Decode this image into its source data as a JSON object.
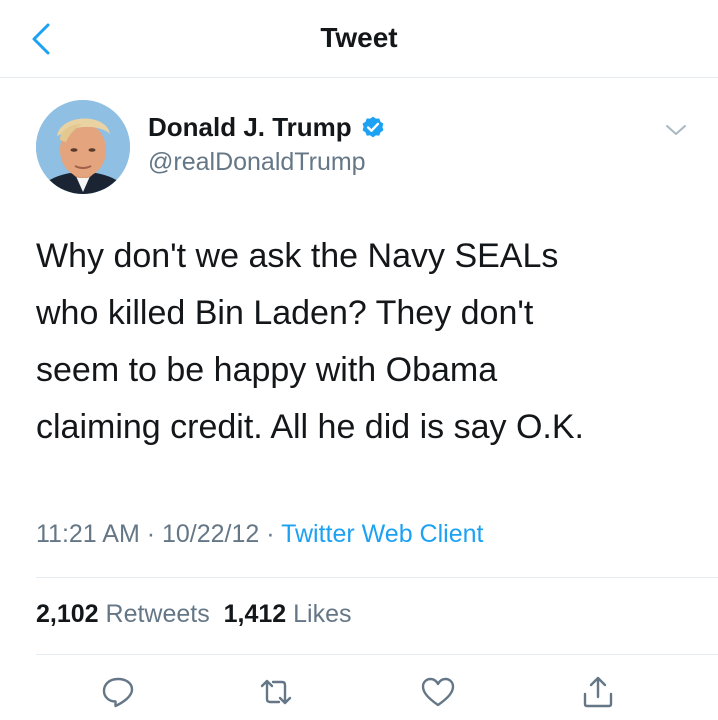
{
  "nav": {
    "title": "Tweet",
    "back_icon": "chevron-left-icon"
  },
  "author": {
    "name": "Donald J. Trump",
    "handle": "@realDonaldTrump",
    "verified_icon": "verified-badge-icon",
    "avatar": "profile-photo"
  },
  "tweet": {
    "text_lines": [
      "Why don't we ask the Navy SEALs",
      "who killed Bin Laden? They don't",
      "seem to be happy with Obama",
      "claiming credit. All he did is say O.K."
    ]
  },
  "meta": {
    "time": "11:21 AM",
    "sep1": " · ",
    "date": "10/22/12",
    "sep2": " · ",
    "client": "Twitter Web Client"
  },
  "stats": {
    "retweets_count": "2,102",
    "retweets_label": "Retweets",
    "likes_count": "1,412",
    "likes_label": "Likes"
  },
  "actions": [
    {
      "icon": "reply-icon"
    },
    {
      "icon": "retweet-icon"
    },
    {
      "icon": "like-icon"
    },
    {
      "icon": "share-icon"
    }
  ],
  "colors": {
    "accent": "#1da1f2",
    "text_primary": "#14171a",
    "text_secondary": "#657786",
    "divider": "#e6ecf0"
  }
}
